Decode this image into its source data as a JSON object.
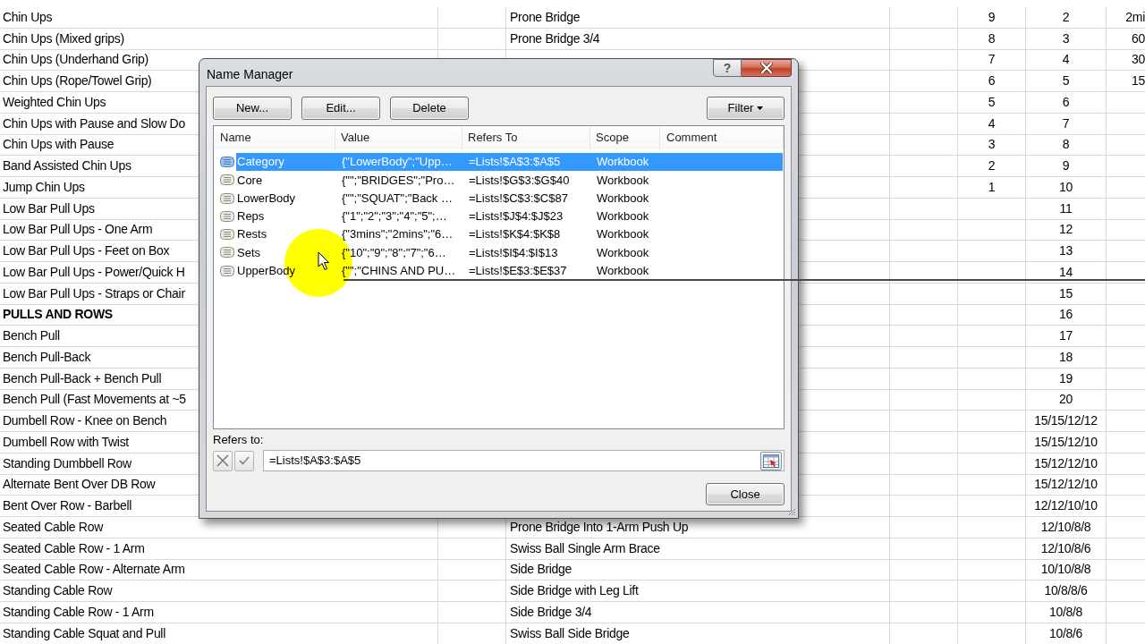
{
  "sheet": {
    "rows": [
      {
        "kind": "item",
        "column_1": "Chin Ups",
        "column_3": "Prone Bridge",
        "column_5": "9",
        "column_6": "2",
        "column_7": "2mi"
      },
      {
        "kind": "item",
        "column_1": "Chin Ups (Mixed grips)",
        "column_3": "Prone Bridge 3/4",
        "column_5": "8",
        "column_6": "3",
        "column_7": "60"
      },
      {
        "kind": "item",
        "column_1": "Chin Ups (Underhand Grip)",
        "column_5": "7",
        "column_6": "4",
        "column_7": "30"
      },
      {
        "kind": "item",
        "column_1": "Chin Ups (Rope/Towel Grip)",
        "column_5": "6",
        "column_6": "5",
        "column_7": "15"
      },
      {
        "kind": "item",
        "column_1": "Weighted Chin Ups",
        "column_5": "5",
        "column_6": "6"
      },
      {
        "kind": "item",
        "column_1": "Chin Ups with Pause and Slow Do",
        "column_5": "4",
        "column_6": "7"
      },
      {
        "kind": "item",
        "column_1": "Chin Ups with Pause",
        "column_5": "3",
        "column_6": "8"
      },
      {
        "kind": "item",
        "column_1": "Band Assisted Chin Ups",
        "column_5": "2",
        "column_6": "9"
      },
      {
        "kind": "item",
        "column_1": "Jump Chin Ups",
        "column_5": "1",
        "column_6": "10"
      },
      {
        "kind": "item",
        "column_1": "Low Bar Pull Ups",
        "column_6": "11"
      },
      {
        "kind": "item",
        "column_1": "Low Bar Pull Ups - One Arm",
        "column_6": "12"
      },
      {
        "kind": "item",
        "column_1": "Low Bar Pull Ups - Feet on Box",
        "column_6": "13"
      },
      {
        "kind": "item",
        "column_1": "Low Bar Pull Ups - Power/Quick H",
        "column_6": "14"
      },
      {
        "kind": "item",
        "column_1": "Low Bar Pull Ups - Straps or Chair",
        "column_6": "15"
      },
      {
        "kind": "heading",
        "column_1": "PULLS AND ROWS",
        "column_6": "16"
      },
      {
        "kind": "item",
        "column_1": "Bench Pull",
        "column_6": "17"
      },
      {
        "kind": "item",
        "column_1": "Bench Pull-Back",
        "column_6": "18"
      },
      {
        "kind": "item",
        "column_1": "Bench Pull-Back + Bench Pull",
        "column_6": "19"
      },
      {
        "kind": "item",
        "column_1": "Bench Pull (Fast Movements at ~5",
        "column_6": "20"
      },
      {
        "kind": "item",
        "column_1": "Dumbell Row - Knee on Bench",
        "column_6": "15/15/12/12"
      },
      {
        "kind": "item",
        "column_1": "Dumbell Row with Twist",
        "column_6": "15/15/12/10"
      },
      {
        "kind": "item",
        "column_1": "Standing Dumbbell Row",
        "column_6": "15/12/12/10"
      },
      {
        "kind": "item",
        "column_1": "Alternate Bent Over DB Row",
        "column_6": "15/12/12/10"
      },
      {
        "kind": "item",
        "column_1": "Bent Over Row - Barbell",
        "column_6": "12/12/10/10"
      },
      {
        "kind": "item",
        "column_1": "Seated Cable Row",
        "column_3": "Prone Bridge Into 1-Arm Push Up",
        "column_6": "12/10/8/8"
      },
      {
        "kind": "item",
        "column_1": "Seated Cable Row - 1 Arm",
        "column_3": "Swiss Ball Single Arm Brace",
        "column_6": "12/10/8/6"
      },
      {
        "kind": "item",
        "column_1": "Seated Cable Row - Alternate Arm",
        "column_3": "Side Bridge",
        "column_6": "10/10/8/8"
      },
      {
        "kind": "item",
        "column_1": "Standing Cable Row",
        "column_3": "Side Bridge with Leg Lift",
        "column_6": "10/8/8/6"
      },
      {
        "kind": "item",
        "column_1": "Standing Cable Row - 1 Arm",
        "column_3": "Side Bridge 3/4",
        "column_6": "10/8/8"
      },
      {
        "kind": "item",
        "column_1": "Standing Cable Squat and Pull",
        "column_3": "Swiss Ball Side Bridge",
        "column_6": "10/8/6"
      }
    ]
  },
  "dialog": {
    "title": "Name Manager",
    "help_button": "?",
    "buttons": [
      "New...",
      "Edit...",
      "Delete"
    ],
    "filter_button": "Filter",
    "names_list": {
      "columns": [
        "Name",
        "Value",
        "Refers To",
        "Scope",
        "Comment"
      ],
      "rows": [
        {
          "name": "Category",
          "value": "{\"LowerBody\";\"Upp…",
          "refers_to": "=Lists!$A$3:$A$5",
          "scope": "Workbook",
          "selected": true
        },
        {
          "name": "Core",
          "value": "{\"\";\"BRIDGES\";\"Pro…",
          "refers_to": "=Lists!$G$3:$G$40",
          "scope": "Workbook",
          "selected": false
        },
        {
          "name": "LowerBody",
          "value": "{\"\";\"SQUAT\";\"Back …",
          "refers_to": "=Lists!$C$3:$C$87",
          "scope": "Workbook",
          "selected": false
        },
        {
          "name": "Reps",
          "value": "{\"1\";\"2\";\"3\";\"4\";\"5\";…",
          "refers_to": "=Lists!$J$4:$J$23",
          "scope": "Workbook",
          "selected": false
        },
        {
          "name": "Rests",
          "value": "{\"3mins\";\"2mins\";\"6…",
          "refers_to": "=Lists!$K$4:$K$8",
          "scope": "Workbook",
          "selected": false
        },
        {
          "name": "Sets",
          "value": "{\"10\";\"9\";\"8\";\"7\";\"6…",
          "refers_to": "=Lists!$I$4:$I$13",
          "scope": "Workbook",
          "selected": false
        },
        {
          "name": "UpperBody",
          "value": "{\"\";\"CHINS AND PU…",
          "refers_to": "=Lists!$E$3:$E$37",
          "scope": "Workbook",
          "selected": false
        }
      ]
    },
    "refers_to": {
      "label": "Refers to:",
      "value": "=Lists!$A$3:$A$5"
    },
    "close_button": "Close"
  }
}
